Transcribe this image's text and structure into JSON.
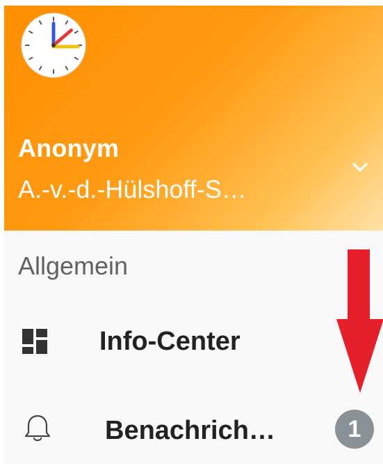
{
  "app": {
    "logo_icon": "clock-icon"
  },
  "header": {
    "account_name": "Anonym",
    "account_email": "A.-v.-d.-Hülshoff-S…",
    "expand_icon": "chevron-down-icon",
    "gradient_start": "#ff8f00",
    "gradient_end": "#ffe1a8"
  },
  "menu": {
    "section_title": "Allgemein",
    "items": [
      {
        "label": "Info-Center",
        "icon": "dashboard-icon"
      },
      {
        "label": "Benachrich…",
        "icon": "bell-icon",
        "badge": "1"
      }
    ]
  },
  "annotation": {
    "arrow_icon": "red-down-arrow-icon",
    "color": "#e5202a"
  }
}
